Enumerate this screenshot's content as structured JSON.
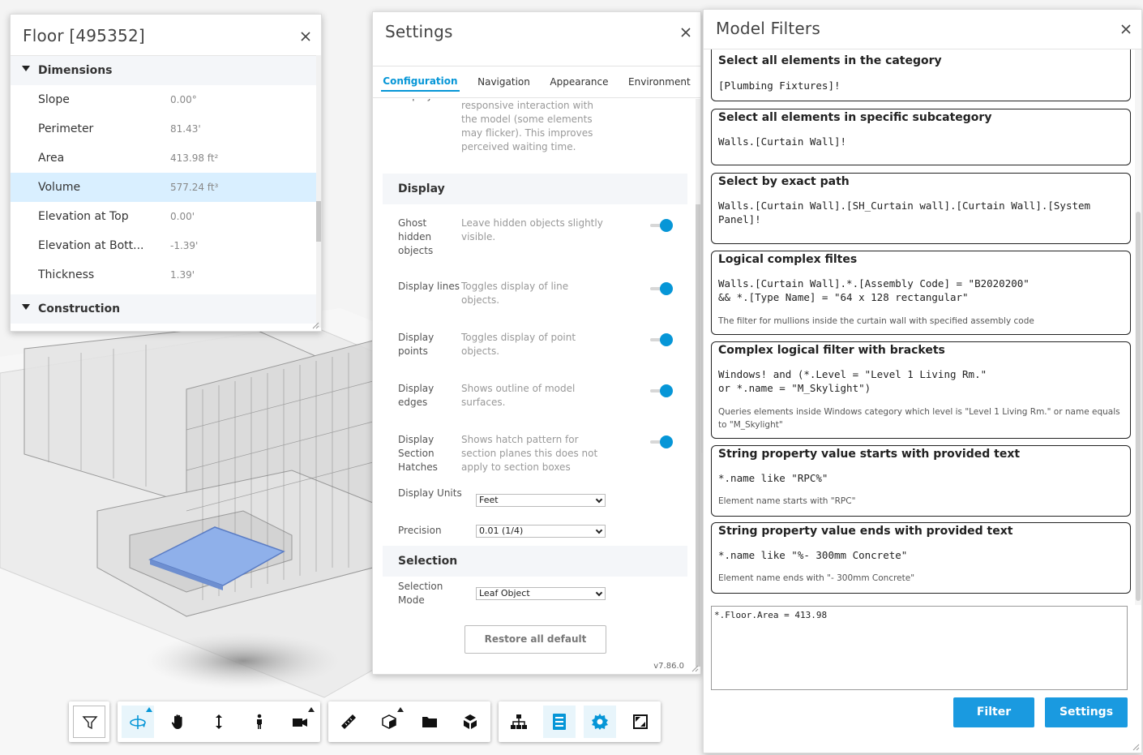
{
  "colors": {
    "accent": "#0696d7",
    "button_blue": "#1a9ae0",
    "highlight_row": "#d9efff",
    "selection_fill": "#8fb0ea"
  },
  "properties_panel": {
    "title": "Floor [495352]",
    "categories": [
      {
        "label": "Dimensions",
        "rows": [
          {
            "name": "Slope",
            "value": "0.00°"
          },
          {
            "name": "Perimeter",
            "value": "81.43'"
          },
          {
            "name": "Area",
            "value": "413.98 ft²"
          },
          {
            "name": "Volume",
            "value": "577.24 ft³",
            "highlighted": true
          },
          {
            "name": "Elevation at Top",
            "value": "0.00'"
          },
          {
            "name": "Elevation at Bott...",
            "value": "-1.39'"
          },
          {
            "name": "Thickness",
            "value": "1.39'"
          }
        ]
      },
      {
        "label": "Construction",
        "rows": []
      }
    ]
  },
  "settings_panel": {
    "title": "Settings",
    "tabs": [
      {
        "label": "Configuration",
        "active": true
      },
      {
        "label": "Navigation",
        "active": false
      },
      {
        "label": "Appearance",
        "active": false
      },
      {
        "label": "Environment",
        "active": false
      }
    ],
    "partial_row": {
      "name": "display",
      "description": "the view and allows for more responsive interaction with the model (some elements may flicker). This improves perceived waiting time."
    },
    "display_section": {
      "header": "Display",
      "rows": [
        {
          "name": "Ghost hidden objects",
          "description": "Leave hidden objects slightly visible.",
          "enabled": true
        },
        {
          "name": "Display lines",
          "description": "Toggles display of line objects.",
          "enabled": true
        },
        {
          "name": "Display points",
          "description": "Toggles display of point objects.",
          "enabled": true
        },
        {
          "name": "Display edges",
          "description": "Shows outline of model surfaces.",
          "enabled": true
        },
        {
          "name": "Display Section Hatches",
          "description": "Shows hatch pattern for section planes this does not apply to section boxes",
          "enabled": true
        }
      ],
      "units_label": "Display Units",
      "units_value": "Feet",
      "precision_label": "Precision",
      "precision_value": "0.01 (1/4)"
    },
    "selection_section": {
      "header": "Selection",
      "mode_label": "Selection Mode",
      "mode_value": "Leaf Object"
    },
    "restore_label": "Restore all default settings",
    "version": "v7.86.0"
  },
  "filters_panel": {
    "title": "Model Filters",
    "cards": [
      {
        "title": "Select all elements in the category",
        "code": "[Plumbing Fixtures]!",
        "description": ""
      },
      {
        "title": "Select all elements in specific subcategory",
        "code": "Walls.[Curtain Wall]!",
        "description": ""
      },
      {
        "title": "Select by exact path",
        "code": "Walls.[Curtain Wall].[SH_Curtain wall].[Curtain Wall].[System Panel]!",
        "description": ""
      },
      {
        "title": "Logical complex filtes",
        "code": "Walls.[Curtain Wall].*.[Assembly Code] = \"B2020200\"\n&& *.[Type Name] = \"64 x 128 rectangular\"",
        "description": "The filter for mullions inside the curtain wall with specified assembly code"
      },
      {
        "title": "Complex logical filter with brackets",
        "code": "Windows! and (*.Level = \"Level 1 Living Rm.\"\nor *.name = \"M_Skylight\")",
        "description": "Queries elements inside Windows category which level is \"Level 1 Living Rm.\" or name equals to \"M_Skylight\""
      },
      {
        "title": "String property value starts with provided text",
        "code": "*.name like \"RPC%\"",
        "description": "Element name starts with \"RPC\""
      },
      {
        "title": "String property value ends with provided text",
        "code": "*.name like \"%- 300mm Concrete\"",
        "description": "Element name ends with \"- 300mm Concrete\""
      }
    ],
    "query_value": "*.Floor.Area = 413.98",
    "filter_button": "Filter",
    "settings_button": "Settings"
  },
  "toolbar": {
    "groups": [
      [
        {
          "icon": "filter-icon",
          "active": false
        }
      ],
      [
        {
          "icon": "orbit-icon",
          "active": true
        },
        {
          "icon": "pan-icon",
          "active": false
        },
        {
          "icon": "zoom-icon",
          "active": false
        },
        {
          "icon": "first-person-icon",
          "active": false
        },
        {
          "icon": "camera-icon",
          "active": false
        }
      ],
      [
        {
          "icon": "measure-icon",
          "active": false
        },
        {
          "icon": "section-icon",
          "active": false
        },
        {
          "icon": "folder-icon",
          "active": false
        },
        {
          "icon": "explode-icon",
          "active": false
        }
      ],
      [
        {
          "icon": "model-browser-icon",
          "active": false
        },
        {
          "icon": "properties-icon",
          "active": true
        },
        {
          "icon": "settings-gear-icon",
          "active": true
        },
        {
          "icon": "fullscreen-icon",
          "active": false
        }
      ]
    ]
  }
}
